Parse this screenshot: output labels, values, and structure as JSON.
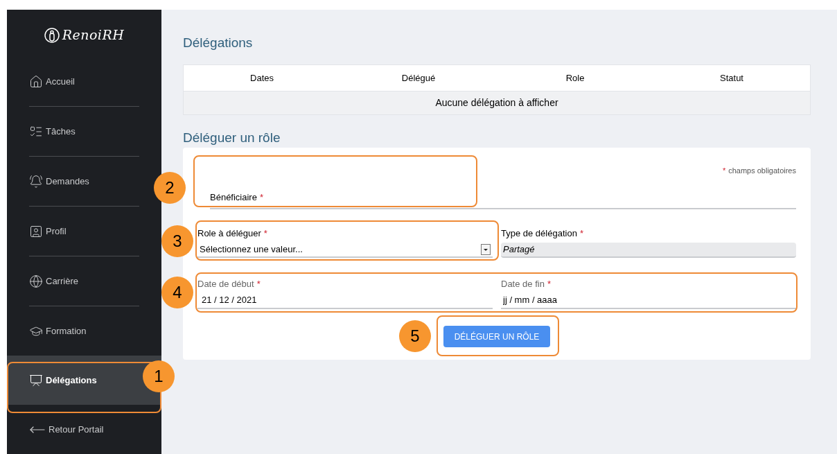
{
  "sidebar": {
    "logo": "RenoiRH",
    "items": [
      {
        "label": "Accueil",
        "selected": false,
        "kind": "link"
      },
      {
        "label": "Tâches",
        "selected": false,
        "kind": "link"
      },
      {
        "label": "Demandes",
        "selected": false,
        "kind": "link"
      },
      {
        "label": "Profil",
        "selected": false,
        "kind": "link"
      },
      {
        "label": "Carrière",
        "selected": false,
        "kind": "link"
      },
      {
        "label": "Formation",
        "selected": false,
        "kind": "link"
      },
      {
        "label": "Délégations",
        "selected": true,
        "kind": "link"
      },
      {
        "label": "Retour Portail",
        "selected": false,
        "kind": "back"
      }
    ]
  },
  "delegations": {
    "title": "Délégations",
    "table": {
      "columns": [
        "Dates",
        "Délégué",
        "Role",
        "Statut"
      ],
      "empty_message": "Aucune délégation à afficher"
    }
  },
  "form": {
    "title": "Déléguer un rôle",
    "required_mark": "*",
    "required_note": "champs obligatoires",
    "beneficiary": {
      "label": "Bénéficiaire",
      "required": true
    },
    "role": {
      "label": "Role à déléguer",
      "required": true,
      "value": "Sélectionnez une valeur...",
      "disabled": false
    },
    "type": {
      "label": "Type de délégation",
      "required": true,
      "value": "Partagé",
      "disabled": true
    },
    "start_date": {
      "label": "Date de début",
      "required": true,
      "value": "21 / 12 / 2021"
    },
    "end_date": {
      "label": "Date de fin",
      "required": true,
      "placeholder": "jj / mm / aaaa"
    },
    "submit": "DÉLÉGUER UN RÔLE"
  },
  "callouts": [
    {
      "label": "1"
    },
    {
      "label": "2"
    },
    {
      "label": "3"
    },
    {
      "label": "4"
    },
    {
      "label": "5"
    }
  ]
}
